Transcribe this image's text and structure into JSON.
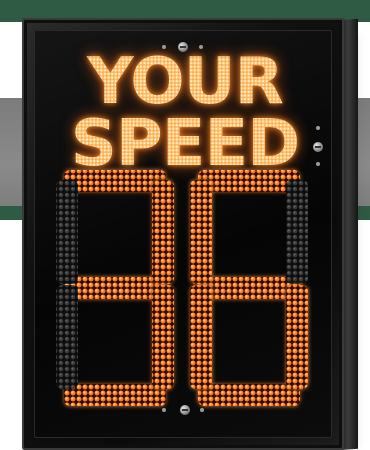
{
  "sign": {
    "headline_line_1": "YOUR",
    "headline_line_2": "SPEED",
    "speed": "36",
    "led_color": "#ff8a2a",
    "housing_color": "#0a0a0a"
  }
}
